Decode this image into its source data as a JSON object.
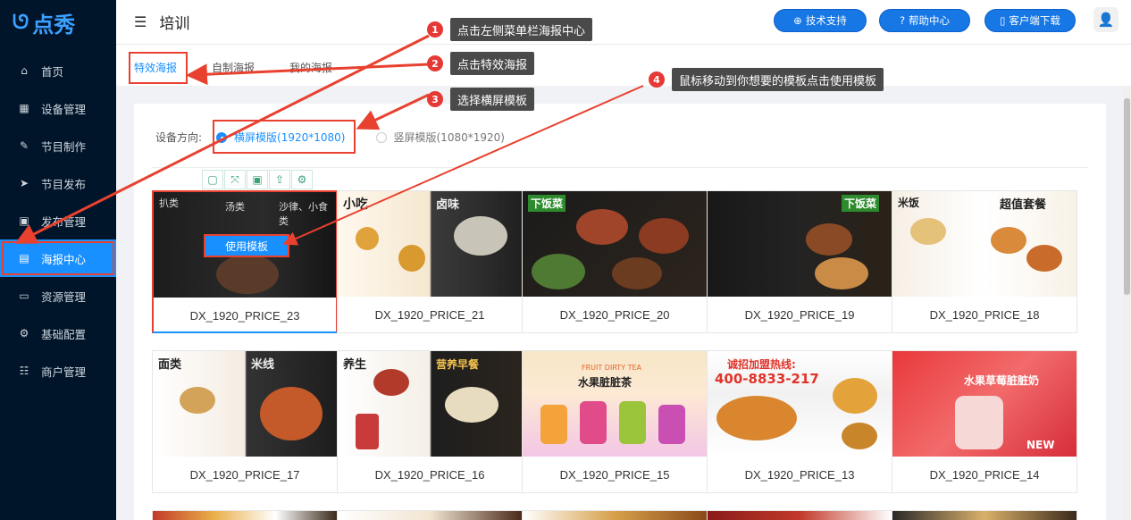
{
  "brand": {
    "logo_text": "点秀"
  },
  "sidebar": {
    "items": [
      {
        "label": "首页",
        "icon": "home-icon",
        "glyph": "⌂",
        "active": false
      },
      {
        "label": "设备管理",
        "icon": "device-icon",
        "glyph": "▦",
        "active": false
      },
      {
        "label": "节目制作",
        "icon": "edit-icon",
        "glyph": "✎",
        "active": false
      },
      {
        "label": "节目发布",
        "icon": "send-icon",
        "glyph": "➤",
        "active": false
      },
      {
        "label": "发布管理",
        "icon": "publish-icon",
        "glyph": "▣",
        "active": false
      },
      {
        "label": "海报中心",
        "icon": "poster-icon",
        "glyph": "▤",
        "active": true
      },
      {
        "label": "资源管理",
        "icon": "folder-icon",
        "glyph": "▭",
        "active": false
      },
      {
        "label": "基础配置",
        "icon": "gear-icon",
        "glyph": "⚙",
        "active": false
      },
      {
        "label": "商户管理",
        "icon": "merchant-icon",
        "glyph": "☷",
        "active": false
      }
    ]
  },
  "header": {
    "title": "培训",
    "support_label": "技术支持",
    "help_label": "帮助中心",
    "download_label": "客户端下载"
  },
  "tabs": {
    "effect": "特效海报",
    "custom": "自制海报",
    "mine": "我的海报"
  },
  "orientation": {
    "label": "设备方向:",
    "landscape": "横屏模版(1920*1080)",
    "portrait": "竖屏模版(1080*1920)",
    "selected": "landscape"
  },
  "use_template_label": "使用模板",
  "templates_row1": [
    "DX_1920_PRICE_23",
    "DX_1920_PRICE_21",
    "DX_1920_PRICE_20",
    "DX_1920_PRICE_19",
    "DX_1920_PRICE_18"
  ],
  "templates_row2": [
    "DX_1920_PRICE_17",
    "DX_1920_PRICE_16",
    "DX_1920_PRICE_15",
    "DX_1920_PRICE_13",
    "DX_1920_PRICE_14"
  ],
  "callouts": [
    {
      "num": "1",
      "text": "点击左侧菜单栏海报中心"
    },
    {
      "num": "2",
      "text": "点击特效海报"
    },
    {
      "num": "3",
      "text": "选择横屏模板"
    },
    {
      "num": "4",
      "text": "鼠标移动到你想要的模板点击使用模板"
    }
  ],
  "thumb_text": {
    "t23": [
      "扒类",
      "汤类",
      "沙律、小食类"
    ],
    "t21": [
      "小吃",
      "卤味"
    ],
    "t20": [
      "下饭菜"
    ],
    "t19": [
      "下饭菜"
    ],
    "t18": [
      "米饭",
      "超值套餐"
    ],
    "t17": [
      "面类",
      "米线"
    ],
    "t16": [
      "养生",
      "营养早餐"
    ],
    "t15": [
      "水果脏脏茶",
      "FRUIT DIRTY TEA"
    ],
    "t13": [
      "诚招加盟热线:",
      "400-8833-217"
    ],
    "t14": [
      "水果草莓脏脏奶",
      "NEW"
    ]
  },
  "colors": {
    "accent": "#1890ff",
    "sidebar_bg": "#001529",
    "annotation_red": "#e8412f"
  }
}
